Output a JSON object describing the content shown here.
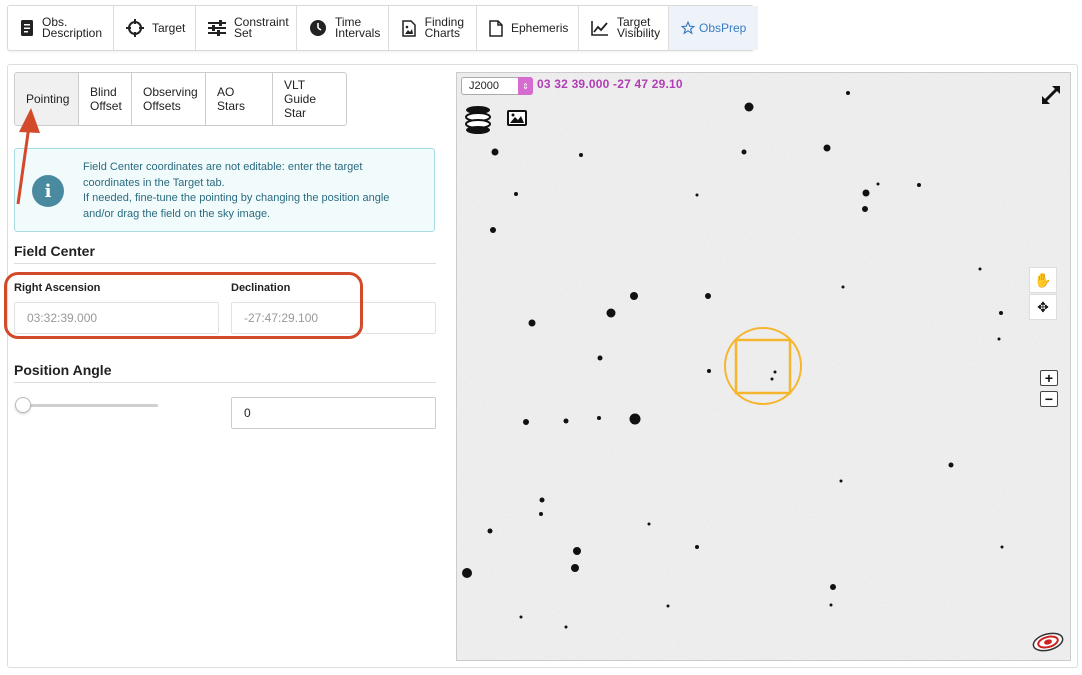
{
  "top_tabs": [
    {
      "label_line1": "Obs.",
      "label_line2": "Description",
      "icon": "document-icon"
    },
    {
      "label_line1": "Target",
      "label_line2": "",
      "icon": "crosshair-icon"
    },
    {
      "label_line1": "Constraint",
      "label_line2": "Set",
      "icon": "sliders-icon"
    },
    {
      "label_line1": "Time",
      "label_line2": "Intervals",
      "icon": "clock-icon"
    },
    {
      "label_line1": "Finding",
      "label_line2": "Charts",
      "icon": "image-file-icon"
    },
    {
      "label_line1": "Ephemeris",
      "label_line2": "",
      "icon": "file-icon"
    },
    {
      "label_line1": "Target",
      "label_line2": "Visibility",
      "icon": "line-chart-icon"
    },
    {
      "label_line1": "ObsPrep",
      "label_line2": "",
      "icon": "star-icon"
    }
  ],
  "sub_tabs": [
    {
      "l1": "Pointing",
      "l2": ""
    },
    {
      "l1": "Blind",
      "l2": "Offset"
    },
    {
      "l1": "Observing",
      "l2": "Offsets"
    },
    {
      "l1": "AO Stars",
      "l2": ""
    },
    {
      "l1": "VLT Guide",
      "l2": "Star"
    }
  ],
  "info": {
    "line1": "Field Center coordinates are not editable: enter the target",
    "line2": "coordinates in the Target tab.",
    "line3": "If needed, fine-tune the pointing by changing the position angle",
    "line4": "and/or drag the field on the sky image."
  },
  "field_center": {
    "title": "Field Center",
    "ra_label": "Right Ascension",
    "ra_value": "03:32:39.000",
    "dec_label": "Declination",
    "dec_value": "-27:47:29.100"
  },
  "position_angle": {
    "title": "Position Angle",
    "value": "0",
    "slider_fraction": 0
  },
  "sky_view": {
    "frame": "J2000",
    "coordinates": "03 32 39.000 -27 47 29.10",
    "fov_color": "#f5b52e"
  },
  "colors": {
    "accent": "#3a7cc4",
    "annotation": "#d24a2a",
    "coords": "#b13db5"
  }
}
